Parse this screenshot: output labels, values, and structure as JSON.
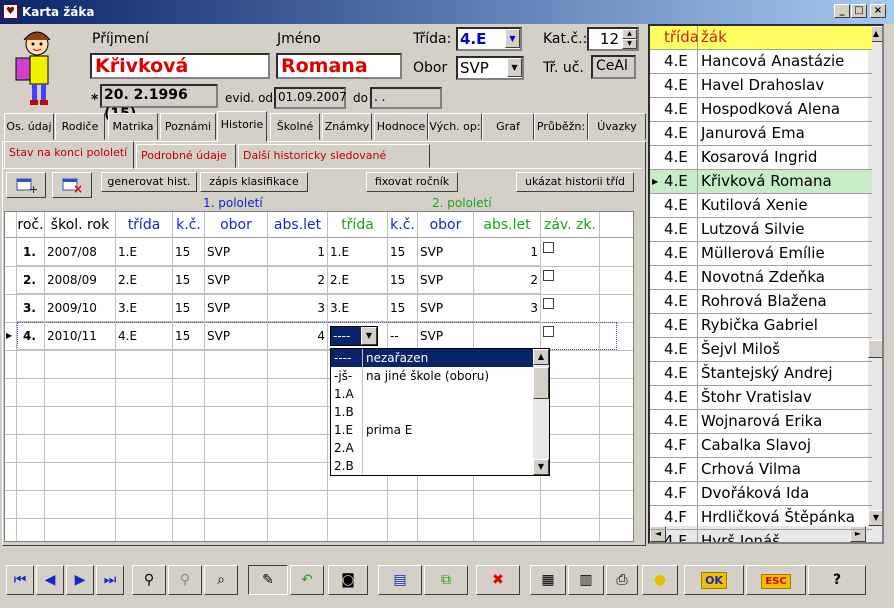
{
  "window": {
    "title": "Karta žáka",
    "minimize": "_",
    "restore": "□",
    "close": "×"
  },
  "labels": {
    "prijmeni": "Příjmení",
    "jmeno": "Jméno",
    "trida": "Třída:",
    "kat": "Kat.č.:",
    "obor": "Obor",
    "tr_uc": "Tř. uč.",
    "evid_od": "evid. od",
    "do": "do"
  },
  "student": {
    "prijmeni": "Křivková",
    "jmeno": "Romana",
    "trida": "4.E",
    "kat": "12",
    "obor": "SVP",
    "tr_uc": "CeAl",
    "birth_prefix": "*",
    "birth": "20. 2.1996 (15)",
    "evid_od": "01.09.2007",
    "do": " .  ."
  },
  "tabs": [
    "Os. údaj",
    "Rodiče",
    "Matrika",
    "Poznámi",
    "Historie",
    "Školné",
    "Známky",
    "Hodnoce",
    "Vých. op:",
    "Graf",
    "Průběžn:",
    "Úvazky"
  ],
  "subtabs": [
    "Stav na konci pololetí",
    "Podrobné údaje",
    "Další historicky sledované změny"
  ],
  "buttons": {
    "gen": "generovat hist.",
    "zapis": "zápis klasifikace",
    "fix": "fixovat ročník",
    "hist": "ukázat historii tříd"
  },
  "pololeti": {
    "p1": "1. pololetí",
    "p2": "2. pololetí"
  },
  "grid_headers": [
    "roč.",
    "škol. rok",
    "třída",
    "k.č.",
    "obor",
    "abs.let",
    "třída",
    "k.č.",
    "obor",
    "abs.let",
    "záv. zk."
  ],
  "grid_rows": [
    {
      "roc": "1.",
      "rok": "2007/08",
      "t1": "1.E",
      "k1": "15",
      "o1": "SVP",
      "a1": "1",
      "t2": "1.E",
      "k2": "15",
      "o2": "SVP",
      "a2": "1"
    },
    {
      "roc": "2.",
      "rok": "2008/09",
      "t1": "2.E",
      "k1": "15",
      "o1": "SVP",
      "a1": "2",
      "t2": "2.E",
      "k2": "15",
      "o2": "SVP",
      "a2": "2"
    },
    {
      "roc": "3.",
      "rok": "2009/10",
      "t1": "3.E",
      "k1": "15",
      "o1": "SVP",
      "a1": "3",
      "t2": "3.E",
      "k2": "15",
      "o2": "SVP",
      "a2": "3"
    },
    {
      "roc": "4.",
      "rok": "2010/11",
      "t1": "4.E",
      "k1": "15",
      "o1": "SVP",
      "a1": "4",
      "t2": "----",
      "k2": "--",
      "o2": "SVP",
      "a2": ""
    }
  ],
  "dropdown": [
    {
      "code": "----",
      "name": "nezařazen"
    },
    {
      "code": "-jš-",
      "name": "na jiné škole (oboru)"
    },
    {
      "code": "1.A",
      "name": ""
    },
    {
      "code": "1.B",
      "name": ""
    },
    {
      "code": "1.E",
      "name": "prima E"
    },
    {
      "code": "2.A",
      "name": ""
    },
    {
      "code": "2.B",
      "name": ""
    }
  ],
  "right_list": {
    "headers": {
      "trida": "třída",
      "zak": "žák"
    },
    "rows": [
      {
        "t": "4.E",
        "n": "Hancová Anastázie"
      },
      {
        "t": "4.E",
        "n": "Havel Drahoslav"
      },
      {
        "t": "4.E",
        "n": "Hospodková Alena"
      },
      {
        "t": "4.E",
        "n": "Janurová Ema"
      },
      {
        "t": "4.E",
        "n": "Kosarová Ingrid"
      },
      {
        "t": "4.E",
        "n": "Křivková Romana"
      },
      {
        "t": "4.E",
        "n": "Kutilová Xenie"
      },
      {
        "t": "4.E",
        "n": "Lutzová Silvie"
      },
      {
        "t": "4.E",
        "n": "Müllerová Emílie"
      },
      {
        "t": "4.E",
        "n": "Novotná Zdeňka"
      },
      {
        "t": "4.E",
        "n": "Rohrová Blažena"
      },
      {
        "t": "4.E",
        "n": "Rybička Gabriel"
      },
      {
        "t": "4.E",
        "n": "Šejvl Miloš"
      },
      {
        "t": "4.E",
        "n": "Štantejský Andrej"
      },
      {
        "t": "4.E",
        "n": "Štohr Vratislav"
      },
      {
        "t": "4.E",
        "n": "Wojnarová Erika"
      },
      {
        "t": "4.F",
        "n": "Cabalka Slavoj"
      },
      {
        "t": "4.F",
        "n": "Crhová Vilma"
      },
      {
        "t": "4.F",
        "n": "Dvořáková Ida"
      },
      {
        "t": "4.F",
        "n": "Hrdličková Štěpánka"
      },
      {
        "t": "4.F",
        "n": "Hyrš Jonáš"
      }
    ]
  },
  "toolbar": {
    "ok": "OK",
    "esc": "ESC",
    "help": "?"
  }
}
